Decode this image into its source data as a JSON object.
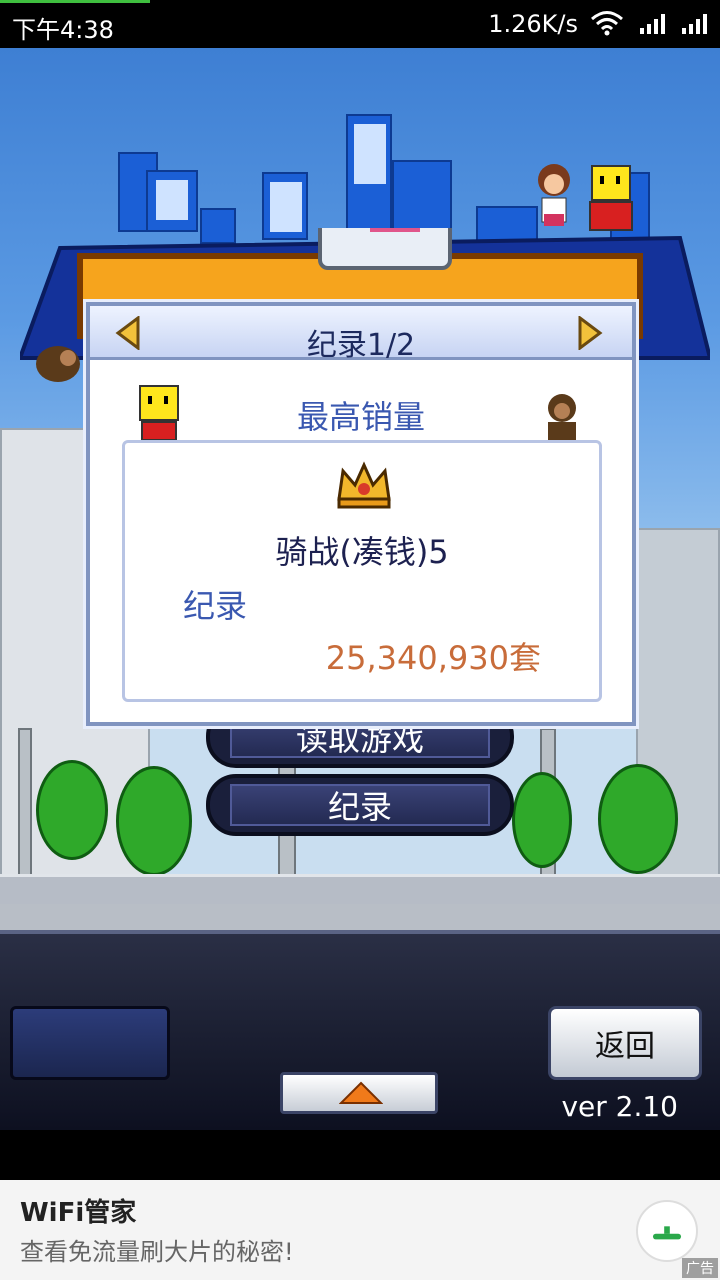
{
  "status_bar": {
    "time": "下午4:38",
    "network_speed": "1.26K/s",
    "icons": [
      "wifi-icon",
      "signal-icon",
      "signal-icon"
    ]
  },
  "dialog": {
    "title": "纪录1/2",
    "subtitle": "最高销量",
    "game_name": "骑战(凑钱)5",
    "record_label": "纪录",
    "record_value": "25,340,930套",
    "icons": [
      "arrow-left-icon",
      "arrow-right-icon",
      "crown-icon"
    ]
  },
  "menu": {
    "partial_button": "读取游戏",
    "records_button": "纪录"
  },
  "hud": {
    "back_label": "返回",
    "version": "ver 2.10",
    "up_icon": "triangle-up-icon"
  },
  "ad": {
    "title": "WiFi管家",
    "description": "查看免流量刷大片的秘密!",
    "tag": "广告"
  },
  "colors": {
    "dialog_title": "#1d2a5e",
    "accent_blue": "#3a58b0",
    "record_value": "#c86c3a"
  }
}
